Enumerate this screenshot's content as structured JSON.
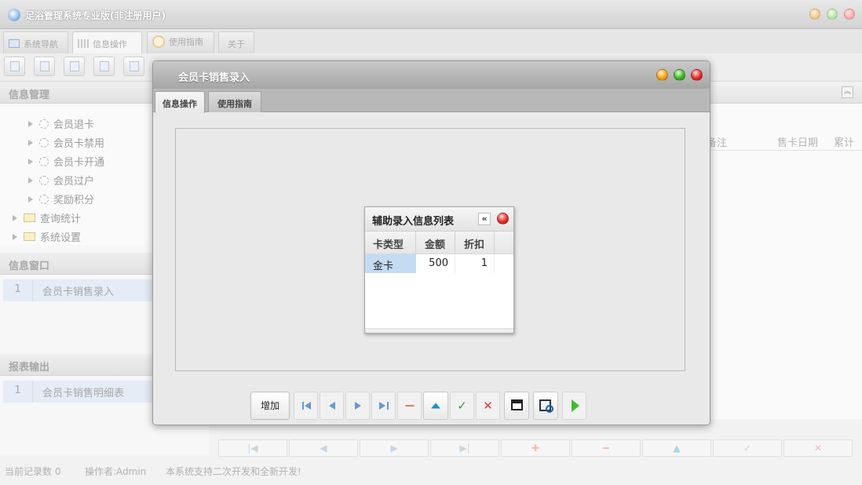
{
  "app": {
    "title": "足浴管理系统专业版(非注册用户)"
  },
  "main_tabs": [
    {
      "label": "系统导航",
      "icon": "monitor-icon"
    },
    {
      "label": "信息操作",
      "icon": "grid-icon"
    },
    {
      "label": "使用指南",
      "icon": "guide-icon"
    },
    {
      "label": "关于"
    }
  ],
  "left": {
    "info_mgmt_title": "信息管理",
    "tree": [
      {
        "label": "会员退卡",
        "type": "leaf"
      },
      {
        "label": "会员卡禁用",
        "type": "leaf"
      },
      {
        "label": "会员卡开通",
        "type": "leaf"
      },
      {
        "label": "会员过户",
        "type": "leaf"
      },
      {
        "label": "奖励积分",
        "type": "leaf"
      },
      {
        "label": "查询统计",
        "type": "folder"
      },
      {
        "label": "系统设置",
        "type": "folder"
      }
    ],
    "info_window_title": "信息窗口",
    "info_window_items": [
      {
        "num": "1",
        "label": "会员卡销售录入"
      }
    ],
    "report_title": "报表输出",
    "report_items": [
      {
        "num": "1",
        "label": "会员卡销售明细表"
      }
    ]
  },
  "right_grid": {
    "columns": [
      "备注",
      "售卡日期",
      "累计"
    ]
  },
  "status": {
    "record_count": "当前记录数 0",
    "operator": "操作者:Admin",
    "note": "本系统支持二次开发和全新开发!"
  },
  "dialog": {
    "title": "会员卡销售录入",
    "tabs": [
      "信息操作",
      "使用指南"
    ],
    "popup": {
      "title": "辅助录入信息列表",
      "collapse_glyph": "«",
      "columns": [
        "卡类型",
        "金额",
        "折扣"
      ],
      "rows": [
        [
          "金卡",
          "500",
          "1"
        ]
      ]
    },
    "toolbar": {
      "add_label": "增加"
    }
  },
  "colors": {
    "dialog_title_bg": "#a6a6a6",
    "selected_cell": "#c4dcf2",
    "nav_blue": "#6b96d4",
    "confirm_green": "#3dbb2f",
    "cancel_red": "#e0312b"
  }
}
